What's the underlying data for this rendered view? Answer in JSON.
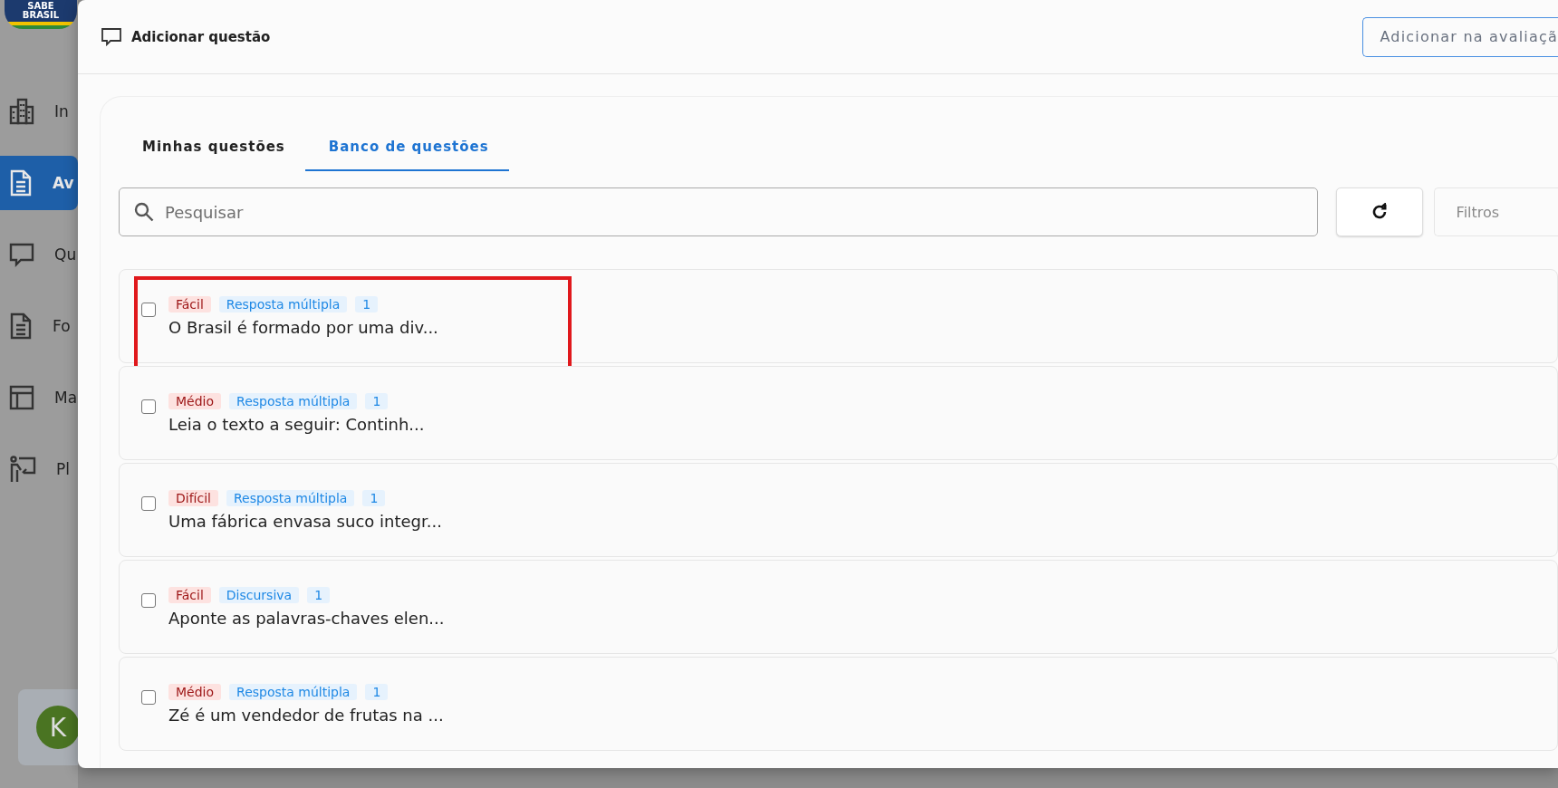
{
  "sidebar": {
    "logo": {
      "line_1": "SABE",
      "line_2": "BRASIL"
    },
    "items": [
      {
        "label": "In",
        "kind": "building",
        "selected": false
      },
      {
        "label": "Av",
        "kind": "document",
        "selected": true
      },
      {
        "label": "Qu",
        "kind": "chat",
        "selected": false
      },
      {
        "label": "Fo",
        "kind": "document",
        "selected": false
      },
      {
        "label": "Ma",
        "kind": "layout",
        "selected": false
      },
      {
        "label": "Pl",
        "kind": "presenter",
        "selected": false
      }
    ],
    "user": {
      "initial": "K"
    }
  },
  "dialog": {
    "title": "Adicionar questão",
    "action_button": "Adicionar na avaliaçã",
    "tabs": [
      {
        "label": "Minhas questões",
        "selected": false
      },
      {
        "label": "Banco de questões",
        "selected": true
      }
    ],
    "search": {
      "placeholder": "Pesquisar"
    },
    "filters_button": "Filtros",
    "questions": [
      {
        "difficulty": "Fácil",
        "type": "Resposta múltipla",
        "count": "1",
        "text": "O Brasil é formado por uma div...",
        "checked": false,
        "highlighted": true
      },
      {
        "difficulty": "Médio",
        "type": "Resposta múltipla",
        "count": "1",
        "text": "Leia o texto a seguir: Continh...",
        "checked": false,
        "highlighted": false
      },
      {
        "difficulty": "Difícil",
        "type": "Resposta múltipla",
        "count": "1",
        "text": "Uma fábrica envasa suco integr...",
        "checked": false,
        "highlighted": false
      },
      {
        "difficulty": "Fácil",
        "type": "Discursiva",
        "count": "1",
        "text": "Aponte as palavras-chaves elen...",
        "checked": false,
        "highlighted": false
      },
      {
        "difficulty": "Médio",
        "type": "Resposta múltipla",
        "count": "1",
        "text": "Zé é um vendedor de frutas na ...",
        "checked": false,
        "highlighted": false
      }
    ]
  }
}
